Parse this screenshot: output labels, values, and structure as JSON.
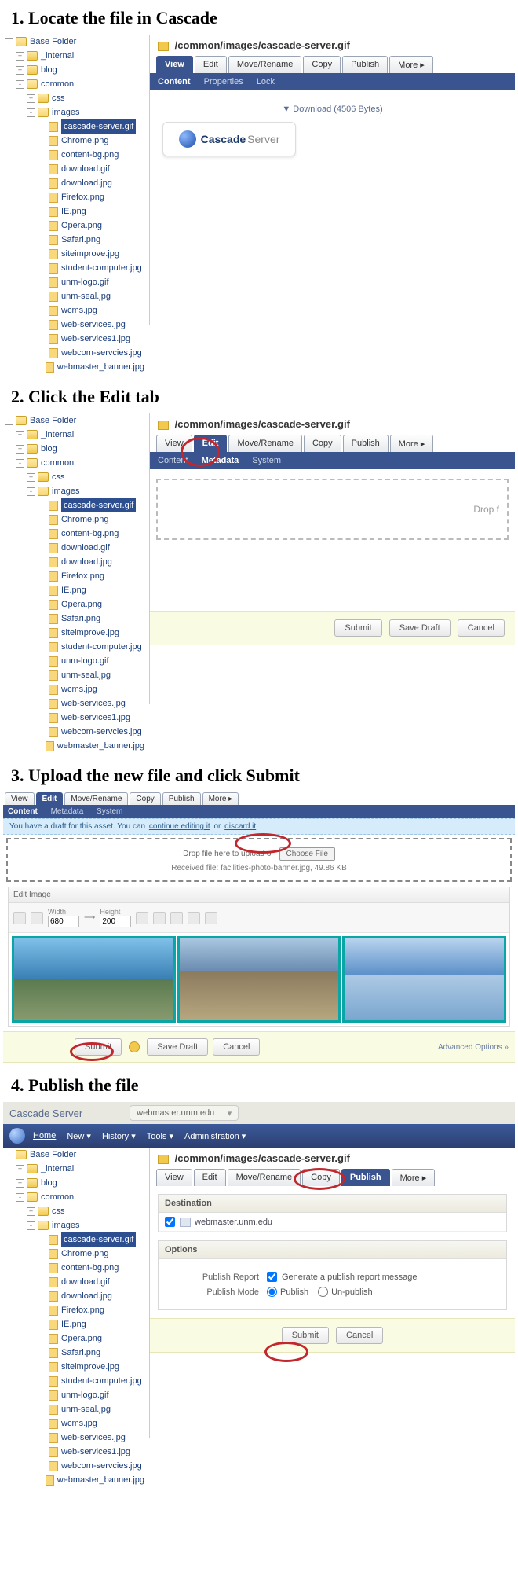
{
  "steps": {
    "s1": "1. Locate the file in Cascade",
    "s2": "2. Click the Edit tab",
    "s3": "3. Upload the new file and click Submit",
    "s4": "4. Publish the file"
  },
  "tree": {
    "base": "Base Folder",
    "internal": "_internal",
    "blog": "blog",
    "common": "common",
    "css": "css",
    "images": "images",
    "files": [
      "cascade-server.gif",
      "Chrome.png",
      "content-bg.png",
      "download.gif",
      "download.jpg",
      "Firefox.png",
      "IE.png",
      "Opera.png",
      "Safari.png",
      "siteimprove.jpg",
      "student-computer.jpg",
      "unm-logo.gif",
      "unm-seal.jpg",
      "wcms.jpg",
      "web-services.jpg",
      "web-services1.jpg",
      "webcom-servcies.jpg",
      "webmaster_banner.jpg"
    ]
  },
  "path": {
    "dir": "/common/images/",
    "file": "cascade-server.gif"
  },
  "tabs": {
    "view": "View",
    "edit": "Edit",
    "move": "Move/Rename",
    "copy": "Copy",
    "publish": "Publish",
    "more": "More ▸"
  },
  "sub_view": {
    "content": "Content",
    "properties": "Properties",
    "lock": "Lock"
  },
  "sub_edit": {
    "content": "Content",
    "metadata": "Metadata",
    "system": "System"
  },
  "download": "Download (4506 Bytes)",
  "logo": {
    "a": "Cascade",
    "b": "Server"
  },
  "drop2": "Drop f",
  "buttons": {
    "submit": "Submit",
    "save": "Save Draft",
    "cancel": "Cancel"
  },
  "step3": {
    "msg_pre": "You have a draft for this asset. You can ",
    "msg_cont": "continue editing it",
    "msg_or": " or ",
    "msg_disc": "discard it",
    "drop_label": "Drop file here to upload or",
    "choose": "Choose File",
    "received": "Received file: facilities-photo-banner.jpg, 49.86 KB",
    "edit_image": "Edit Image",
    "width_l": "Width",
    "width_v": "680",
    "height_l": "Height",
    "height_v": "200",
    "adv": "Advanced Options »"
  },
  "step4": {
    "brand": "Cascade Server",
    "site": "webmaster.unm.edu",
    "menu": {
      "home": "Home",
      "new": "New ▾",
      "history": "History ▾",
      "tools": "Tools ▾",
      "admin": "Administration ▾"
    },
    "dest_hdr": "Destination",
    "dest_val": "webmaster.unm.edu",
    "opt_hdr": "Options",
    "pr_label": "Publish Report",
    "pr_val": "Generate a publish report message",
    "pm_label": "Publish Mode",
    "pm_pub": "Publish",
    "pm_unpub": "Un-publish"
  }
}
